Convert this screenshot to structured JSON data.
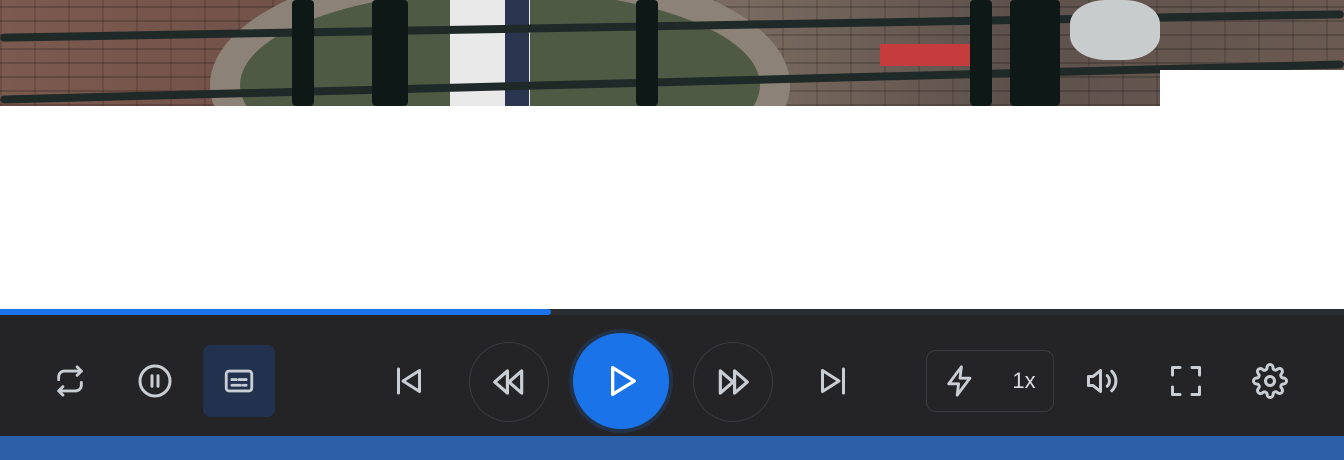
{
  "player": {
    "progress_fraction": 0.41,
    "speed_label": "1x",
    "accent_color": "#1a73e8",
    "controls_background": "#242426",
    "bottom_bar_color": "#2d5ea8"
  },
  "icons": [
    "repeat-icon",
    "pause-circle-icon",
    "subtitles-icon",
    "skip-back-icon",
    "rewind-icon",
    "play-icon",
    "fast-forward-icon",
    "skip-forward-icon",
    "lightning-icon",
    "volume-icon",
    "fullscreen-icon",
    "settings-gear-icon"
  ]
}
